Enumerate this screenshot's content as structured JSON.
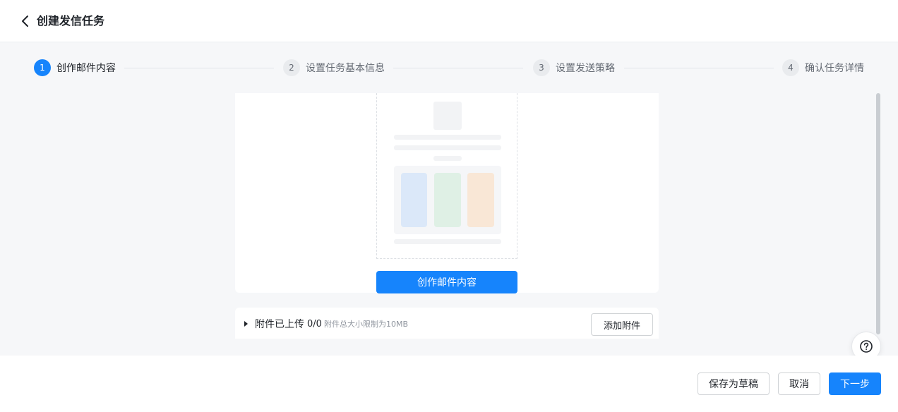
{
  "header": {
    "back_icon": "chevron-left-icon",
    "title": "创建发信任务"
  },
  "steps": [
    {
      "number": "1",
      "label": "创作邮件内容",
      "state": "active"
    },
    {
      "number": "2",
      "label": "设置任务基本信息",
      "state": "todo"
    },
    {
      "number": "3",
      "label": "设置发送策略",
      "state": "todo"
    },
    {
      "number": "4",
      "label": "确认任务详情",
      "state": "todo"
    }
  ],
  "content": {
    "create_button_label": "创作邮件内容"
  },
  "attachments": {
    "label": "附件已上传",
    "count": "0/0",
    "hint": "附件总大小限制为10MB",
    "add_button_label": "添加附件"
  },
  "footer": {
    "save_draft_label": "保存为草稿",
    "cancel_label": "取消",
    "next_label": "下一步"
  },
  "colors": {
    "primary": "#1684fc",
    "placeholder_blue": "#dbe8f9",
    "placeholder_green": "#dff0e5",
    "placeholder_orange": "#f9e7d6"
  },
  "help_icon": "question-circle-icon"
}
